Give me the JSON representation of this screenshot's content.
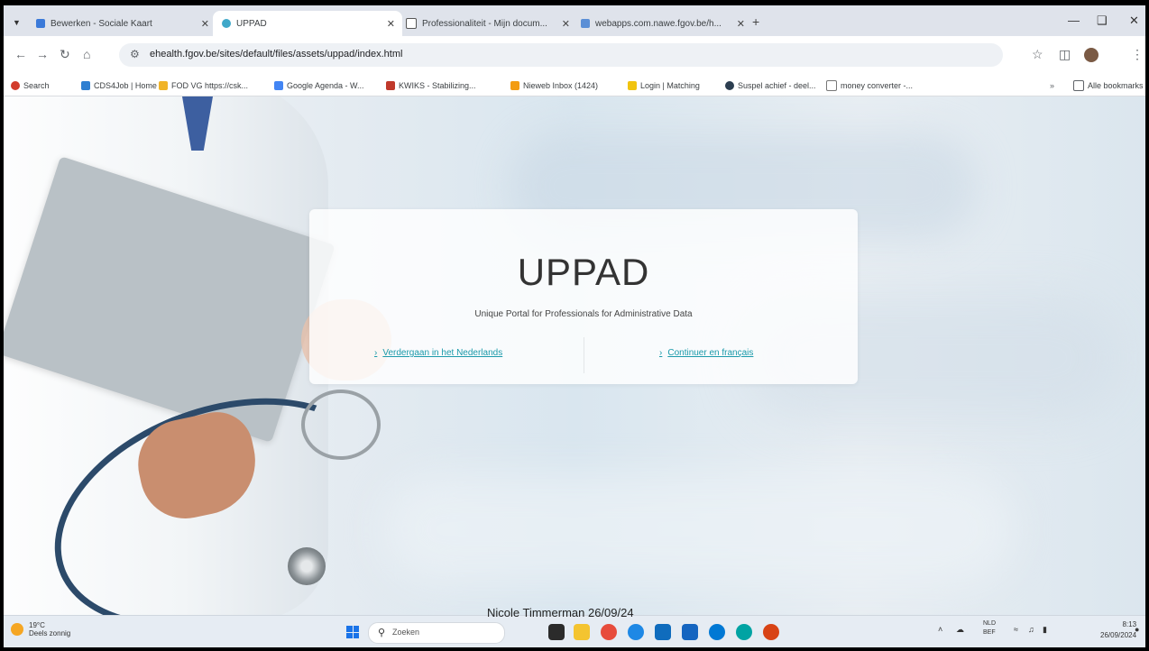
{
  "browser": {
    "tabs": [
      {
        "title": "Bewerken - Sociale Kaart"
      },
      {
        "title": "UPPAD"
      },
      {
        "title": "Professionaliteit - Mijn docum..."
      },
      {
        "title": "webapps.com.nawe.fgov.be/h..."
      }
    ],
    "url": "ehealth.fgov.be/sites/default/files/assets/uppad/index.html",
    "bookmarks": [
      {
        "label": "Search"
      },
      {
        "label": "CDS4Job | Home"
      },
      {
        "label": "FOD VG https://csk..."
      },
      {
        "label": "Google Agenda - W..."
      },
      {
        "label": "KWIKS - Stabilizing..."
      },
      {
        "label": "Nieweb Inbox (1424)"
      },
      {
        "label": "Login | Matching"
      },
      {
        "label": "Suspel achief - deel..."
      },
      {
        "label": "money converter -..."
      }
    ],
    "all_bookmarks": "Alle bookmarks"
  },
  "page": {
    "title": "UPPAD",
    "subtitle": "Unique Portal for Professionals for Administrative Data",
    "link_nl": "Verdergaan in het Nederlands",
    "link_fr": "Continuer en français"
  },
  "taskbar": {
    "weather_temp": "19°C",
    "weather_desc": "Deels zonnig",
    "search_placeholder": "Zoeken",
    "lang_top": "NLD",
    "lang_bottom": "BEF",
    "time": "8:13",
    "date": "26/09/2024"
  },
  "watermark": "Nicole Timmerman 26/09/24"
}
